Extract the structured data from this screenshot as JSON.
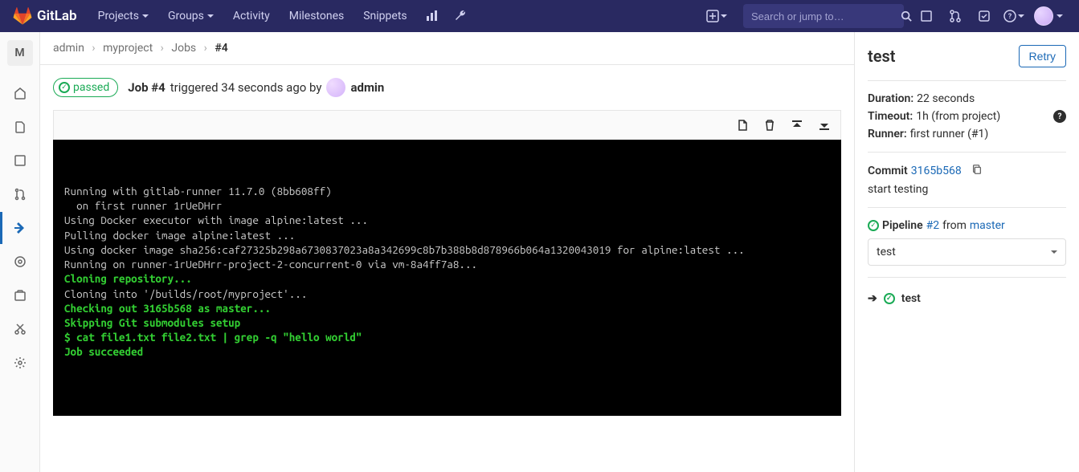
{
  "nav": {
    "brand": "GitLab",
    "projects": "Projects",
    "groups": "Groups",
    "activity": "Activity",
    "milestones": "Milestones",
    "snippets": "Snippets",
    "search_placeholder": "Search or jump to…"
  },
  "breadcrumb": {
    "owner": "admin",
    "project": "myproject",
    "section": "Jobs",
    "current": "#4"
  },
  "job": {
    "status": "passed",
    "title_prefix": "Job #4",
    "triggered_text": "triggered 34 seconds ago by",
    "user": "admin"
  },
  "log": {
    "lines": [
      {
        "t": "Running with gitlab-runner 11.7.0 (8bb608ff)",
        "c": ""
      },
      {
        "t": "  on first runner 1rUeDHrr",
        "c": ""
      },
      {
        "t": "Using Docker executor with image alpine:latest ...",
        "c": ""
      },
      {
        "t": "Pulling docker image alpine:latest ...",
        "c": ""
      },
      {
        "t": "Using docker image sha256:caf27325b298a6730837023a8a342699c8b7b388b8d878966b064a1320043019 for alpine:latest ...",
        "c": ""
      },
      {
        "t": "Running on runner-1rUeDHrr-project-2-concurrent-0 via vm-8a4ff7a8...",
        "c": ""
      },
      {
        "t": "Cloning repository...",
        "c": "green"
      },
      {
        "t": "Cloning into '/builds/root/myproject'...",
        "c": ""
      },
      {
        "t": "Checking out 3165b568 as master...",
        "c": "green"
      },
      {
        "t": "Skipping Git submodules setup",
        "c": "green"
      },
      {
        "t": "$ cat file1.txt file2.txt | grep -q \"hello world\"",
        "c": "green"
      },
      {
        "t": "Job succeeded",
        "c": "green"
      }
    ]
  },
  "right": {
    "title": "test",
    "retry": "Retry",
    "duration_label": "Duration:",
    "duration_value": "22 seconds",
    "timeout_label": "Timeout:",
    "timeout_value": "1h (from project)",
    "runner_label": "Runner:",
    "runner_value": "first runner (#1)",
    "commit_label": "Commit",
    "commit_sha": "3165b568",
    "commit_msg": "start testing",
    "pipeline_label": "Pipeline",
    "pipeline_id": "#2",
    "pipeline_from": "from",
    "pipeline_branch": "master",
    "stage_select": "test",
    "stage_job": "test"
  },
  "sidebar": {
    "project_letter": "M"
  }
}
